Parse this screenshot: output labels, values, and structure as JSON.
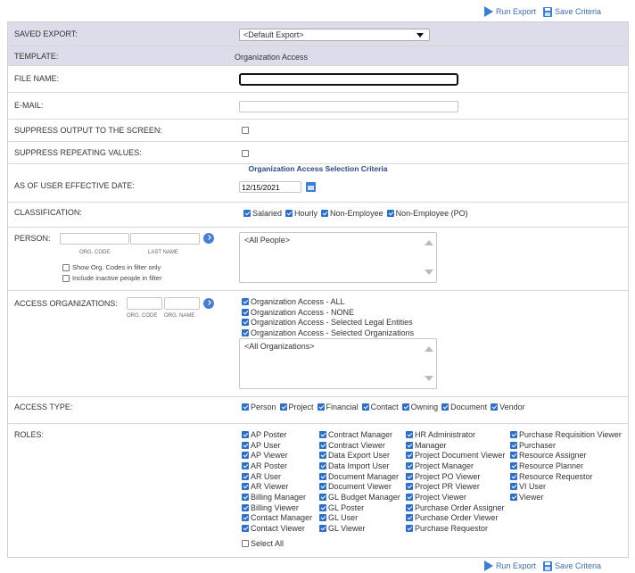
{
  "toolbar": {
    "run_label": "Run Export",
    "save_label": "Save Criteria"
  },
  "fields": {
    "saved_export": {
      "label": "SAVED EXPORT:",
      "value": "<Default Export>"
    },
    "template": {
      "label": "TEMPLATE:",
      "value": "Organization Access"
    },
    "file_name": {
      "label": "FILE NAME:",
      "value": ""
    },
    "email": {
      "label": "E-MAIL:",
      "value": ""
    },
    "suppress_output": {
      "label": "SUPPRESS OUTPUT TO THE SCREEN:"
    },
    "suppress_repeating": {
      "label": "SUPPRESS REPEATING VALUES:"
    }
  },
  "section_title": "Organization Access Selection Criteria",
  "as_of": {
    "label": "AS OF USER EFFECTIVE DATE:",
    "value": "12/15/2021"
  },
  "classification": {
    "label": "CLASSIFICATION:",
    "options": [
      "Salaried",
      "Hourly",
      "Non-Employee",
      "Non-Employee (PO)"
    ]
  },
  "person": {
    "label": "PERSON:",
    "org_code_caption": "ORG. CODE",
    "last_name_caption": "LAST NAME",
    "show_codes_label": "Show Org. Codes in filter only",
    "include_inactive_label": "Include inactive people in filter",
    "list_item": "<All People>"
  },
  "access_orgs": {
    "label": "ACCESS ORGANIZATIONS:",
    "org_code_caption": "ORG. CODE",
    "org_name_caption": "ORG. NAME",
    "options": [
      "Organization Access - ALL",
      "Organization Access - NONE",
      "Organization Access - Selected Legal Entities",
      "Organization Access - Selected Organizations"
    ],
    "list_item": "<All Organizations>"
  },
  "access_type": {
    "label": "ACCESS TYPE:",
    "options": [
      "Person",
      "Project",
      "Financial",
      "Contact",
      "Owning",
      "Document",
      "Vendor"
    ]
  },
  "roles": {
    "label": "ROLES:",
    "col1": [
      "AP Poster",
      "AP User",
      "AP Viewer",
      "AR Poster",
      "AR User",
      "AR Viewer",
      "Billing Manager",
      "Billing Viewer",
      "Contact Manager",
      "Contact Viewer"
    ],
    "col2": [
      "Contract Manager",
      "Contract Viewer",
      "Data Export User",
      "Data Import User",
      "Document Manager",
      "Document Viewer",
      "GL Budget Manager",
      "GL Poster",
      "GL User",
      "GL Viewer"
    ],
    "col3": [
      "HR Administrator",
      "Manager",
      "Project Document Viewer",
      "Project Manager",
      "Project PO Viewer",
      "Project PR Viewer",
      "Project Viewer",
      "Purchase Order Assigner",
      "Purchase Order Viewer",
      "Purchase Requestor"
    ],
    "col4": [
      "Purchase Requisition Viewer",
      "Purchaser",
      "Resource Assigner",
      "Resource Planner",
      "Resource Requestor",
      "VI User",
      "Viewer"
    ],
    "select_all": "Select All"
  }
}
